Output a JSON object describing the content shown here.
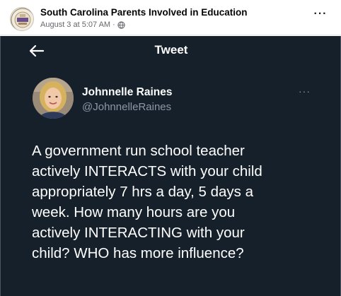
{
  "post": {
    "page_name": "South Carolina Parents Involved in Education",
    "date": "August 3 at 5:07 AM",
    "separator": "·",
    "more_label": "···",
    "avatar_icon": "school-seal-icon",
    "privacy_icon": "globe-icon"
  },
  "tweet": {
    "header_title": "Tweet",
    "back_icon": "back-arrow-icon",
    "author_name": "Johnnelle Raines",
    "author_handle": "@JohnnelleRaines",
    "more_label": "···",
    "lines": [
      "A government run school teacher",
      "actively INTERACTS with your child",
      "appropriately 7 hrs a day, 5 days a",
      "week. How many hours are you",
      "actively INTERACTING with your",
      "child? WHO has more influence?"
    ]
  },
  "colors": {
    "tweet_background": "#15202b",
    "tweet_text": "#ffffff",
    "handle_text": "#8b98a5",
    "fb_meta_text": "#65676b"
  }
}
